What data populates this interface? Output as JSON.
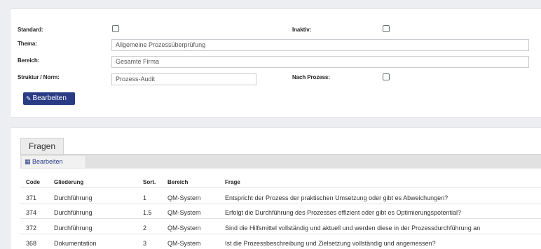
{
  "form": {
    "standard_label": "Standard:",
    "inaktiv_label": "Inaktiv:",
    "thema_label": "Thema:",
    "thema_value": "Allgemeine Prozessüberprüfung",
    "bereich_label": "Bereich:",
    "bereich_value": "Gesamte Firma",
    "struktur_label": "Struktur / Norm:",
    "struktur_value": "Prozess-Audit",
    "nach_prozess_label": "Nach Prozess:",
    "edit_button": "Bearbeiten",
    "standard_checked": false,
    "inaktiv_checked": false,
    "nach_prozess_checked": false
  },
  "questions": {
    "tab_label": "Fragen",
    "toolbar_edit": "Bearbeiten",
    "columns": [
      "Code",
      "Gliederung",
      "Sort.",
      "Bereich",
      "Frage"
    ],
    "rows": [
      [
        "371",
        "Durchführung",
        "1",
        "QM-System",
        "Entspricht der Prozess der praktischen Umsetzung oder gibt es Abweichungen?"
      ],
      [
        "374",
        "Durchführung",
        "1.5",
        "QM-System",
        "Erfolgt die Durchführung des Prozesses effizient oder gibt es Optimierungspotential?"
      ],
      [
        "372",
        "Durchführung",
        "2",
        "QM-System",
        "Sind die Hilfsmittel vollständig und aktuell und werden diese in der Prozessdurchführung an"
      ],
      [
        "368",
        "Dokumentation",
        "3",
        "QM-System",
        "Ist die Prozessbeschreibung und Zielsetzung vollständig und angemessen?"
      ]
    ]
  }
}
